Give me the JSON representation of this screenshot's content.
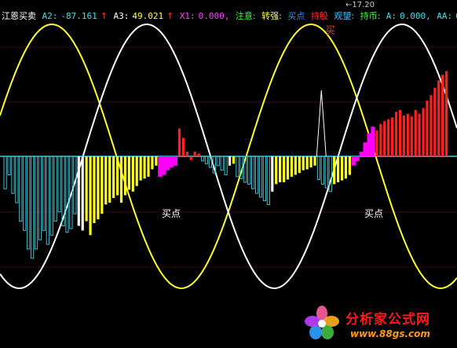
{
  "header": {
    "indicator_name": "江恩买卖",
    "a2_label": "A2:",
    "a2_value": "-87.161",
    "a3_label": "A3:",
    "a3_value": "49.021",
    "x1_label": "X1:",
    "x1_value": "0.000,",
    "note_label": "注意:",
    "strong_label": "转强:",
    "buy_label": "买点",
    "hold_stock_label": "持股",
    "watch_label": "观望:",
    "hold_cash_label": "持币:",
    "a_label": "A:",
    "a_value": "0.000,",
    "aa_label": "AA:",
    "aa_value": "0"
  },
  "top_price_label": "17.20",
  "top_buy_marker": "买",
  "watermark": {
    "title": "分析家公式网",
    "url": "www.88gs.com"
  },
  "colors": {
    "background": "#000000",
    "zero_line": "#40d0e0",
    "yellow_bar": "#ffff20",
    "white_bar": "#ffffff",
    "cyan_bar": "#40c0d0",
    "magenta_bar": "#ff00ff",
    "red_bar": "#ff2020",
    "yellow_curve": "#ffff30",
    "white_curve": "#ffffff",
    "header_cyan": "#40e0e0",
    "header_magenta": "#ff40ff",
    "header_green": "#40ff40",
    "header_yellow": "#ffff40",
    "header_blue": "#4080ff",
    "header_red": "#ff3030",
    "header_orange": "#ff8000"
  },
  "chart_data": {
    "type": "bar",
    "annotations": [
      "买点",
      "买点"
    ],
    "series": [
      {
        "colors": [
          "cyan",
          "cyan",
          "cyan",
          "cyan",
          "cyan",
          "cyan",
          "cyan",
          "cyan",
          "cyan",
          "cyan",
          "cyan",
          "cyan",
          "cyan",
          "cyan",
          "cyan",
          "cyan",
          "cyan",
          "cyan",
          "cyan",
          "white",
          "white",
          "yellow",
          "yellow",
          "yellow",
          "yellow",
          "yellow",
          "yellow",
          "yellow",
          "yellow",
          "yellow",
          "yellow",
          "yellow",
          "yellow",
          "yellow",
          "yellow",
          "yellow",
          "yellow",
          "yellow",
          "yellow",
          "yellow",
          "magenta",
          "magenta",
          "magenta",
          "magenta",
          "magenta",
          "red",
          "red",
          "red",
          "red",
          "red",
          "red",
          "cyan",
          "cyan",
          "cyan",
          "cyan",
          "cyan",
          "cyan",
          "cyan",
          "white",
          "yellow",
          "cyan",
          "cyan",
          "cyan",
          "cyan",
          "cyan",
          "cyan",
          "cyan",
          "cyan",
          "cyan",
          "white",
          "yellow",
          "yellow",
          "yellow",
          "yellow",
          "yellow",
          "yellow",
          "yellow",
          "yellow",
          "yellow",
          "yellow",
          "yellow",
          "cyan",
          "cyan",
          "cyan",
          "cyan",
          "yellow",
          "yellow",
          "yellow",
          "yellow",
          "yellow",
          "magenta",
          "magenta",
          "magenta",
          "magenta",
          "magenta",
          "magenta",
          "red",
          "red",
          "red",
          "red",
          "red",
          "red",
          "red",
          "red",
          "red",
          "red",
          "red",
          "red",
          "red",
          "red",
          "red",
          "red",
          "red",
          "red",
          "red"
        ],
        "values": [
          -35,
          -20,
          -40,
          -50,
          -70,
          -80,
          -100,
          -110,
          -100,
          -90,
          -80,
          -95,
          -85,
          -70,
          -60,
          -75,
          -82,
          -78,
          -62,
          -75,
          -80,
          -70,
          -85,
          -72,
          -68,
          -62,
          -52,
          -50,
          -45,
          -42,
          -50,
          -42,
          -36,
          -38,
          -32,
          -26,
          -24,
          -22,
          -14,
          -10,
          -22,
          -20,
          -15,
          -12,
          -10,
          30,
          20,
          5,
          -4,
          5,
          3,
          -5,
          -8,
          -12,
          -18,
          -10,
          -15,
          -20,
          -10,
          -8,
          -22,
          -24,
          -28,
          -30,
          -35,
          -40,
          -44,
          -48,
          -52,
          -38,
          -30,
          -28,
          -28,
          -25,
          -22,
          -20,
          -18,
          -15,
          -14,
          -12,
          -10,
          -25,
          -30,
          -34,
          -38,
          -30,
          -28,
          -26,
          -24,
          -20,
          -10,
          -5,
          5,
          15,
          25,
          32,
          28,
          35,
          38,
          40,
          42,
          48,
          50,
          44,
          46,
          43,
          50,
          46,
          52,
          60,
          66,
          74,
          82,
          88,
          92
        ]
      }
    ],
    "extra_spike": {
      "value": 120,
      "label": ""
    },
    "ylim": [
      -140,
      130
    ]
  }
}
